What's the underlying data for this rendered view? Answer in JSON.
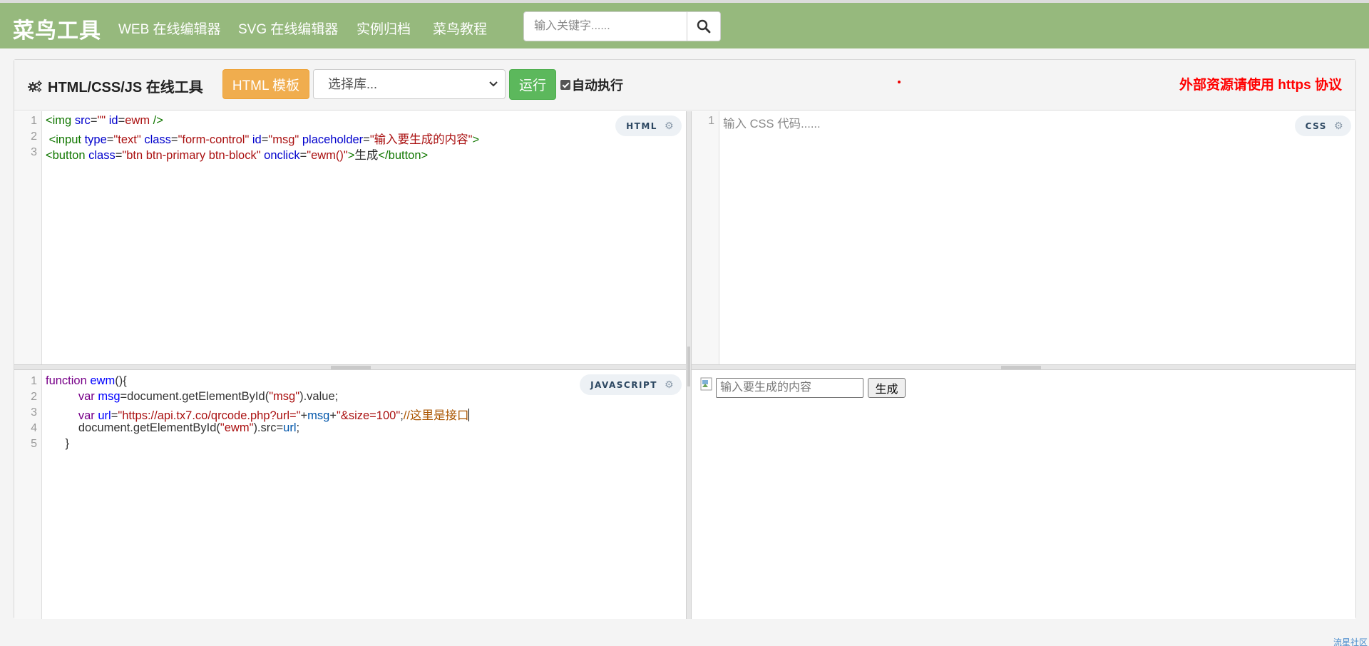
{
  "navbar": {
    "brand": "菜鸟工具",
    "links": [
      "WEB 在线编辑器",
      "SVG 在线编辑器",
      "实例归档",
      "菜鸟教程"
    ],
    "search_placeholder": "输入关键字......",
    "color": "#96b97d"
  },
  "toolbar": {
    "title": "HTML/CSS/JS 在线工具",
    "template_label": "HTML 模板",
    "library_selected": "选择库...",
    "run_label": "运行",
    "auto_label": "自动执行",
    "auto_checked": true,
    "https_note": "外部资源请使用 https 协议"
  },
  "editors": {
    "html": {
      "badge": "HTML",
      "line_numbers": [
        "1",
        "2",
        "3"
      ],
      "lines": [
        [
          {
            "t": "<img ",
            "c": "tag"
          },
          {
            "t": "src",
            "c": "attr"
          },
          {
            "t": "=",
            "c": ""
          },
          {
            "t": "\"\"",
            "c": "str"
          },
          {
            "t": " ",
            "c": ""
          },
          {
            "t": "id",
            "c": "attr"
          },
          {
            "t": "=",
            "c": ""
          },
          {
            "t": "ewm",
            "c": "str"
          },
          {
            "t": " />",
            "c": "tag"
          }
        ],
        [
          {
            "t": " <input ",
            "c": "tag"
          },
          {
            "t": "type",
            "c": "attr"
          },
          {
            "t": "=",
            "c": ""
          },
          {
            "t": "\"text\"",
            "c": "str"
          },
          {
            "t": " ",
            "c": ""
          },
          {
            "t": "class",
            "c": "attr"
          },
          {
            "t": "=",
            "c": ""
          },
          {
            "t": "\"form-control\"",
            "c": "str"
          },
          {
            "t": " ",
            "c": ""
          },
          {
            "t": "id",
            "c": "attr"
          },
          {
            "t": "=",
            "c": ""
          },
          {
            "t": "\"msg\"",
            "c": "str"
          },
          {
            "t": " ",
            "c": ""
          },
          {
            "t": "placeholder",
            "c": "attr"
          },
          {
            "t": "=",
            "c": ""
          },
          {
            "t": "\"输入要生成的内容\"",
            "c": "str"
          },
          {
            "t": ">",
            "c": "tag"
          }
        ],
        [
          {
            "t": "<button ",
            "c": "tag"
          },
          {
            "t": "class",
            "c": "attr"
          },
          {
            "t": "=",
            "c": ""
          },
          {
            "t": "\"btn btn-primary btn-block\"",
            "c": "str"
          },
          {
            "t": " ",
            "c": ""
          },
          {
            "t": "onclick",
            "c": "attr"
          },
          {
            "t": "=",
            "c": ""
          },
          {
            "t": "\"ewm()\"",
            "c": "str"
          },
          {
            "t": ">",
            "c": "tag"
          },
          {
            "t": "生成",
            "c": ""
          },
          {
            "t": "</button>",
            "c": "tag"
          }
        ]
      ]
    },
    "css": {
      "badge": "CSS",
      "line_numbers": [
        "1"
      ],
      "placeholder": "输入 CSS 代码......"
    },
    "js": {
      "badge": "JAVASCRIPT",
      "line_numbers": [
        "1",
        "2",
        "3",
        "4",
        "5"
      ],
      "lines": [
        [
          {
            "t": "function ",
            "c": "kw"
          },
          {
            "t": "ewm",
            "c": "def"
          },
          {
            "t": "(){",
            "c": ""
          }
        ],
        [
          {
            "t": "          ",
            "c": ""
          },
          {
            "t": "var ",
            "c": "kw"
          },
          {
            "t": "msg",
            "c": "def"
          },
          {
            "t": "=document.getElementById(",
            "c": ""
          },
          {
            "t": "\"msg\"",
            "c": "str"
          },
          {
            "t": ").value;",
            "c": ""
          }
        ],
        [
          {
            "t": "          ",
            "c": ""
          },
          {
            "t": "var ",
            "c": "kw"
          },
          {
            "t": "url",
            "c": "def"
          },
          {
            "t": "=",
            "c": ""
          },
          {
            "t": "\"https://api.tx7.co/qrcode.php?url=\"",
            "c": "str"
          },
          {
            "t": "+",
            "c": ""
          },
          {
            "t": "msg",
            "c": "var2"
          },
          {
            "t": "+",
            "c": ""
          },
          {
            "t": "\"&size=100\"",
            "c": "str"
          },
          {
            "t": ";",
            "c": ""
          },
          {
            "t": "//这里是接口",
            "c": "cmt"
          }
        ],
        [
          {
            "t": "          document.getElementById(",
            "c": ""
          },
          {
            "t": "\"ewm\"",
            "c": "str"
          },
          {
            "t": ").src=",
            "c": ""
          },
          {
            "t": "url",
            "c": "var2"
          },
          {
            "t": ";",
            "c": ""
          }
        ],
        [
          {
            "t": "      }",
            "c": ""
          }
        ]
      ]
    }
  },
  "result": {
    "input_placeholder": "输入要生成的内容",
    "button_label": "生成"
  },
  "footer": {
    "link": "流星社区"
  }
}
